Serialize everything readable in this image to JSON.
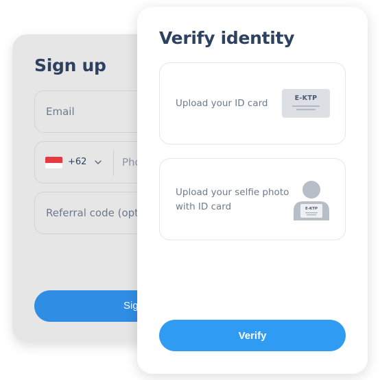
{
  "signup": {
    "title": "Sign up",
    "email_placeholder": "Email",
    "phone": {
      "country_code": "+62",
      "placeholder_visible": "Pho",
      "flag_colors": {
        "top": "#e5393f",
        "bottom": "#fafafa"
      }
    },
    "referral_placeholder_visible": "Referral code (opti",
    "button_label_visible": "Sig"
  },
  "verify": {
    "title": "Verify identity",
    "id_upload": {
      "label": "Upload your ID card",
      "card_text": "E-KTP"
    },
    "selfie_upload": {
      "label": "Upload your selfie photo with ID card",
      "card_text": "E-KTP"
    },
    "button_label": "Verify"
  },
  "colors": {
    "primary_button": "#2f9bf2",
    "background_button": "#2f8de3",
    "title": "#2e4160",
    "muted_text": "#6d7a8c",
    "background_card": "#e6e6e6"
  },
  "icons": [
    "chevron-down-icon",
    "id-card-icon",
    "selfie-with-id-icon",
    "indonesia-flag-icon"
  ]
}
